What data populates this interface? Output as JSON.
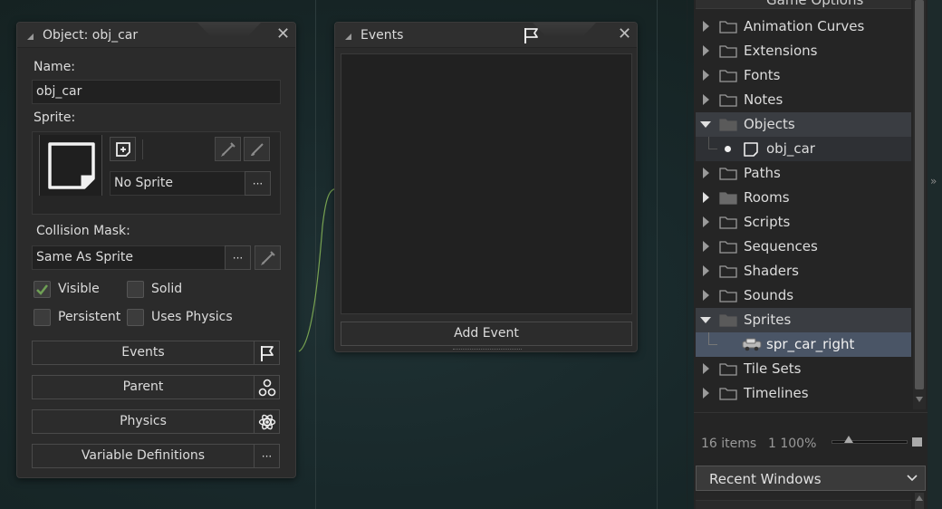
{
  "object_window": {
    "title": "Object: obj_car",
    "name_label": "Name:",
    "name_value": "obj_car",
    "sprite_label": "Sprite:",
    "sprite_value": "No Sprite",
    "collision_label": "Collision Mask:",
    "collision_value": "Same As Sprite",
    "ellipsis": "···",
    "checkboxes": [
      {
        "label": "Visible",
        "checked": true
      },
      {
        "label": "Solid",
        "checked": false
      },
      {
        "label": "Persistent",
        "checked": false
      },
      {
        "label": "Uses Physics",
        "checked": false
      }
    ],
    "buttons": {
      "events": "Events",
      "parent": "Parent",
      "physics": "Physics",
      "variable_definitions": "Variable Definitions"
    }
  },
  "events_window": {
    "title": "Events",
    "add_event": "Add Event"
  },
  "asset_browser": {
    "top_partial": "Game Options",
    "items": [
      {
        "label": "Animation Curves",
        "state": "collapsed"
      },
      {
        "label": "Extensions",
        "state": "collapsed"
      },
      {
        "label": "Fonts",
        "state": "collapsed"
      },
      {
        "label": "Notes",
        "state": "collapsed"
      },
      {
        "label": "Objects",
        "state": "expanded"
      },
      {
        "label": "obj_car",
        "state": "child"
      },
      {
        "label": "Paths",
        "state": "collapsed"
      },
      {
        "label": "Rooms",
        "state": "collapsed-filled"
      },
      {
        "label": "Scripts",
        "state": "collapsed"
      },
      {
        "label": "Sequences",
        "state": "collapsed"
      },
      {
        "label": "Shaders",
        "state": "collapsed"
      },
      {
        "label": "Sounds",
        "state": "collapsed"
      },
      {
        "label": "Sprites",
        "state": "expanded"
      },
      {
        "label": "spr_car_right",
        "state": "child-sprite"
      },
      {
        "label": "Tile Sets",
        "state": "collapsed"
      },
      {
        "label": "Timelines",
        "state": "collapsed"
      }
    ],
    "count": "16 items",
    "zoom": "1 100%",
    "recent_windows": "Recent Windows"
  },
  "colors": {
    "accent_curve": "#8fbf5a",
    "selection": "#4a5566"
  }
}
